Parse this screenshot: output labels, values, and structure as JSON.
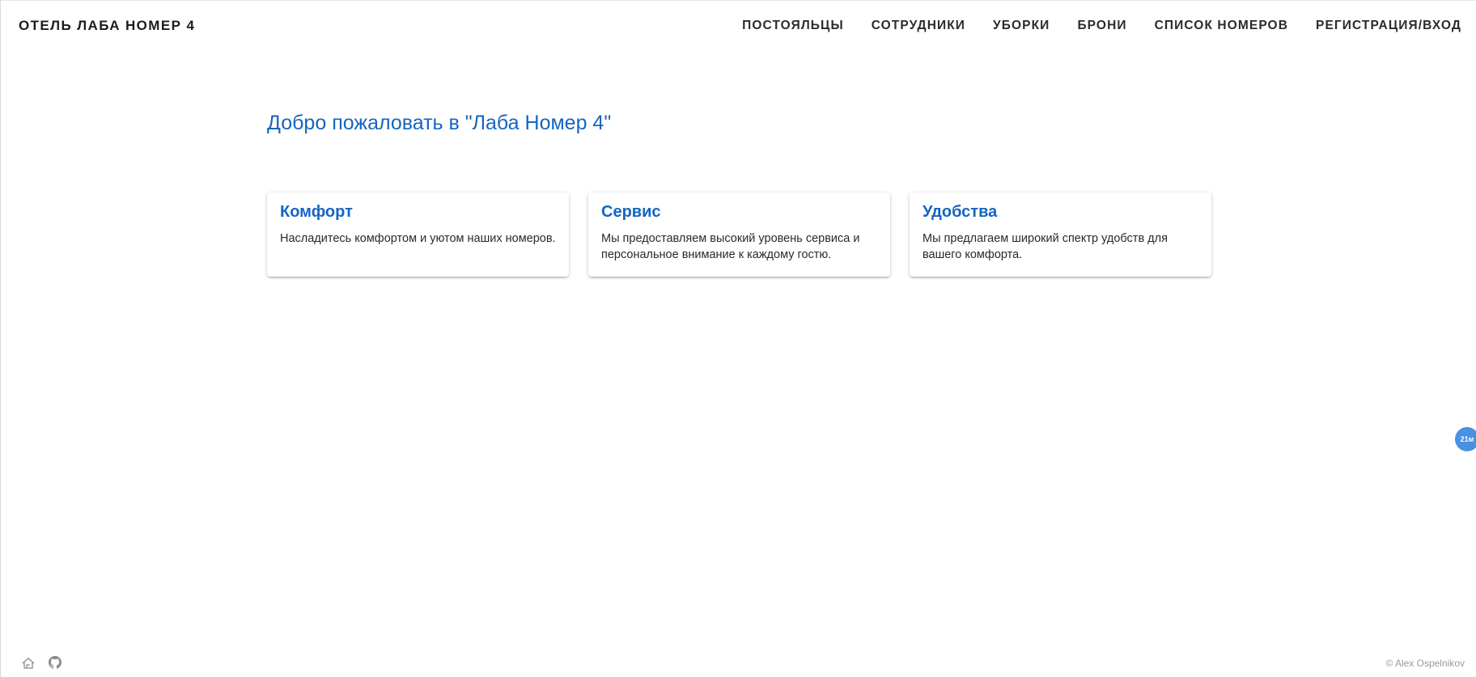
{
  "header": {
    "brand": "ОТЕЛЬ ЛАБА НОМЕР 4",
    "nav": [
      {
        "label": "ПОСТОЯЛЬЦЫ"
      },
      {
        "label": "СОТРУДНИКИ"
      },
      {
        "label": "УБОРКИ"
      },
      {
        "label": "БРОНИ"
      },
      {
        "label": "СПИСОК НОМЕРОВ"
      },
      {
        "label": "РЕГИСТРАЦИЯ/ВХОД"
      }
    ]
  },
  "main": {
    "welcome": "Добро пожаловать в \"Лаба Номер 4\"",
    "cards": [
      {
        "title": "Комфорт",
        "text": "Насладитесь комфортом и уютом наших номеров."
      },
      {
        "title": "Сервис",
        "text": "Мы предоставляем высокий уровень сервиса и персональное внимание к каждому гостю."
      },
      {
        "title": "Удобства",
        "text": "Мы предлагаем широкий спектр удобств для вашего комфорта."
      }
    ]
  },
  "fab": {
    "label": "21м"
  },
  "footer": {
    "icons": [
      {
        "name": "home-icon"
      },
      {
        "name": "github-icon"
      }
    ],
    "copyright": "© Alex Ospelnikov"
  },
  "colors": {
    "accent": "#1565c0",
    "fab": "#4a90e2"
  }
}
